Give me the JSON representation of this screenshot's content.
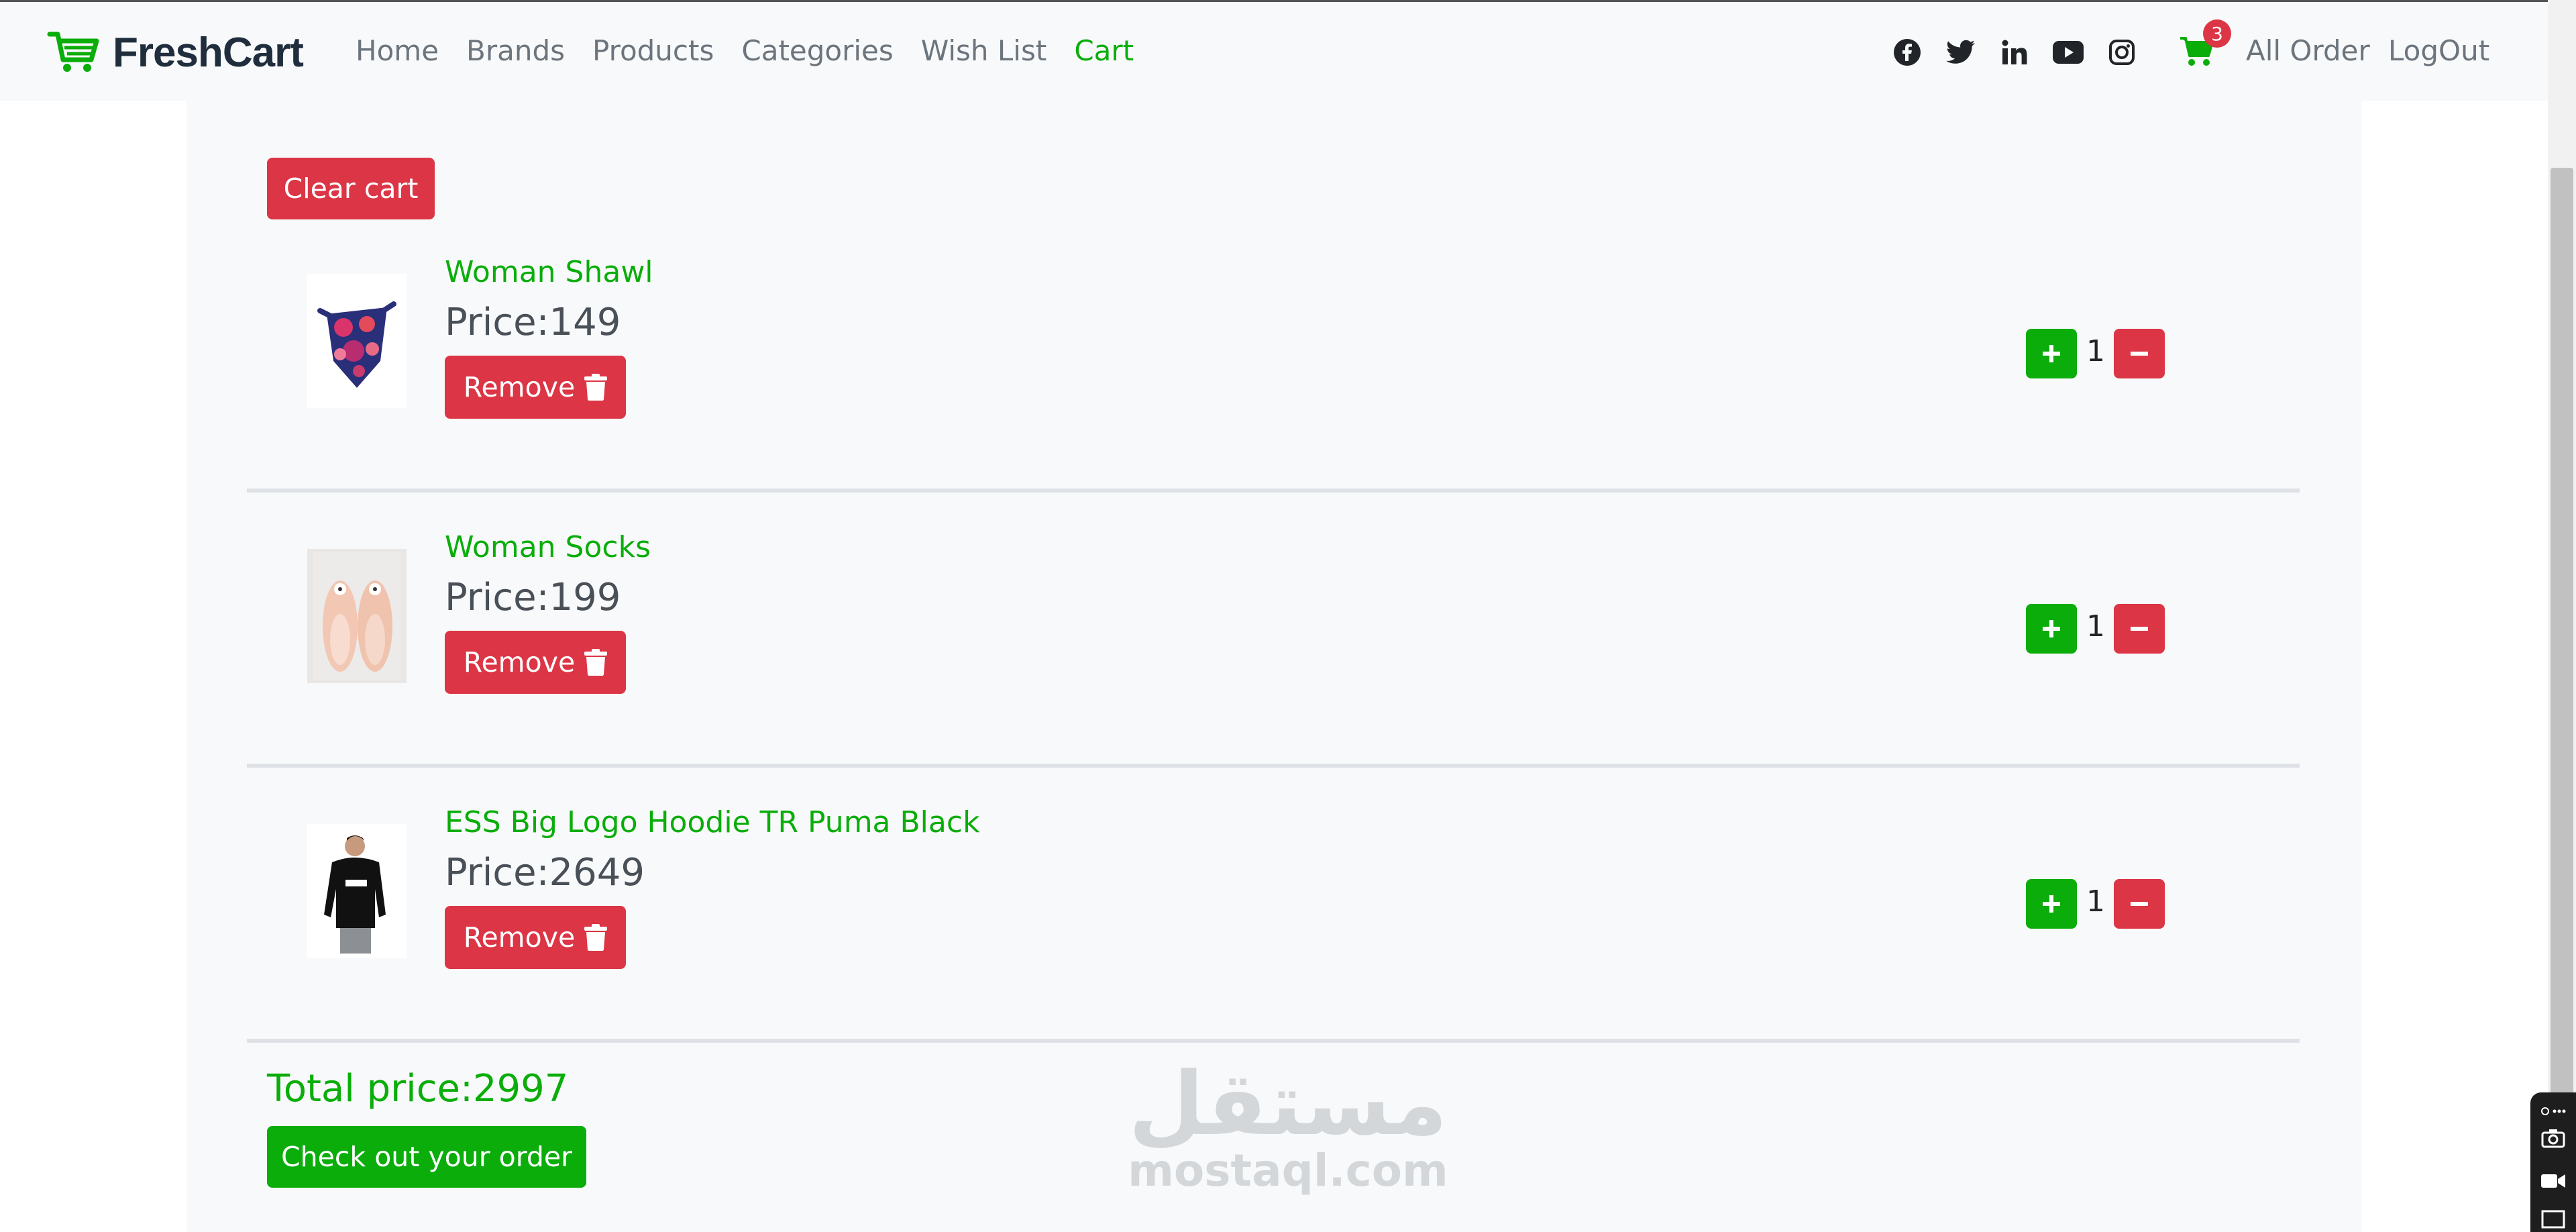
{
  "brand": {
    "name": "FreshCart"
  },
  "nav": {
    "links": [
      {
        "label": "Home"
      },
      {
        "label": "Brands"
      },
      {
        "label": "Products"
      },
      {
        "label": "Categories"
      },
      {
        "label": "Wish List"
      },
      {
        "label": "Cart"
      }
    ],
    "active": "Cart",
    "socials": [
      "facebook-icon",
      "twitter-icon",
      "linkedin-icon",
      "youtube-icon",
      "instagram-icon"
    ],
    "cart_count": "3",
    "all_orders": "All Order",
    "logout": "LogOut"
  },
  "cart": {
    "clear_label": "Clear cart",
    "remove_label": "Remove",
    "items": [
      {
        "title": "Woman Shawl",
        "price": "Price:149",
        "qty": "1"
      },
      {
        "title": "Woman Socks",
        "price": "Price:199",
        "qty": "1"
      },
      {
        "title": "ESS Big Logo Hoodie TR Puma Black",
        "price": "Price:2649",
        "qty": "1"
      }
    ],
    "total": "Total price:2997",
    "checkout_label": "Check out your order"
  },
  "watermark": {
    "arabic": "مستقل",
    "latin": "mostaql.com"
  },
  "colors": {
    "accent": "#0aad0a",
    "danger": "#dc3545",
    "navbar_bg": "#f8f9fa"
  }
}
